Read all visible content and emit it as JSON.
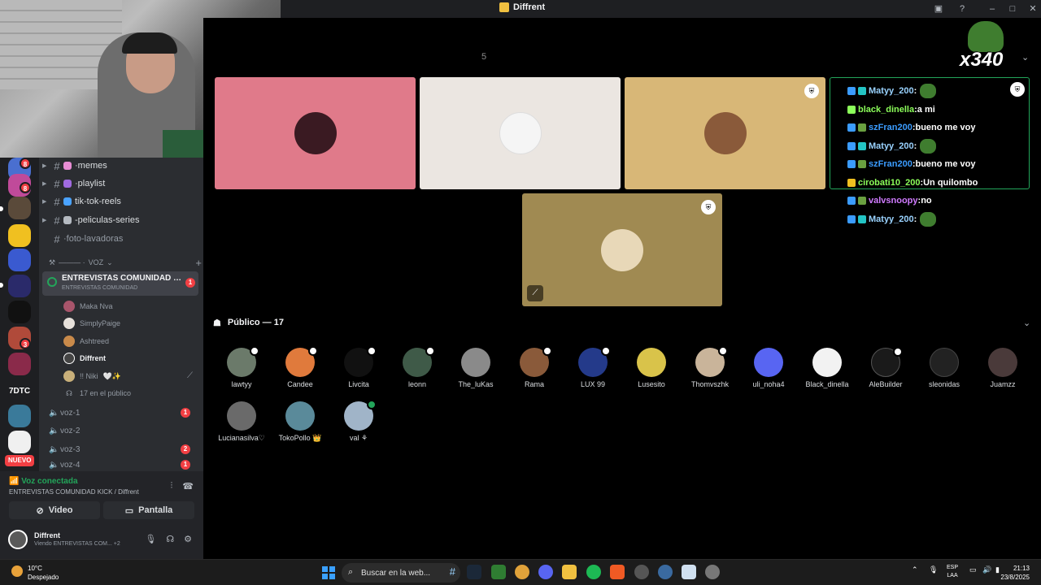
{
  "window": {
    "title": "Diffrent"
  },
  "stage_overlay": {
    "counter": "x340"
  },
  "chat": [
    {
      "user": "Matyy_200",
      "user_color": "#9ad3ff",
      "text": "",
      "emote": true
    },
    {
      "user": "black_dinella",
      "user_color": "#8cff5a",
      "text": "a mi",
      "emote": false
    },
    {
      "user": "szFran200",
      "user_color": "#3b9cff",
      "text": "bueno me voy",
      "emote": false
    },
    {
      "user": "Matyy_200",
      "user_color": "#9ad3ff",
      "text": "",
      "emote": true
    },
    {
      "user": "szFran200",
      "user_color": "#3b9cff",
      "text": "bueno me voy",
      "emote": false
    },
    {
      "user": "cirobati10_200",
      "user_color": "#8cff5a",
      "text": "Un quilombo",
      "emote": false
    },
    {
      "user": "valvsnoopy",
      "user_color": "#d07bff",
      "text": "no",
      "emote": false
    },
    {
      "user": "Matyy_200",
      "user_color": "#9ad3ff",
      "text": "",
      "emote": true
    }
  ],
  "chat_sep": " : ",
  "channels": {
    "text": [
      {
        "label": "memes",
        "prefix": "· ",
        "icon_color": "#e88dd4",
        "muted": false
      },
      {
        "label": "playlist",
        "prefix": "· ",
        "icon_color": "#a06be0",
        "muted": false
      },
      {
        "label": "tik-tok-reels",
        "prefix": "",
        "icon_color": "#4aa3ff",
        "muted": false
      },
      {
        "label": "-peliculas-series",
        "prefix": "",
        "icon_color": "#b5bac1",
        "muted": false
      },
      {
        "label": "foto-lavadoras",
        "prefix": "· ",
        "icon_color": "",
        "muted": true
      }
    ],
    "voice_category": "VOZ",
    "voice_category_prefix": "——— ·",
    "active_voice": {
      "name": "ENTREVISTAS COMUNIDAD K...",
      "sub": "ENTREVISTAS COMUNIDAD",
      "badge": "1"
    },
    "voice_users": [
      {
        "name": "Maka Nva",
        "bright": false,
        "color": "#a8556b"
      },
      {
        "name": "SimplyPaige",
        "bright": false,
        "color": "#e6e0da"
      },
      {
        "name": "Ashtreed",
        "bright": false,
        "color": "#c98a4a"
      },
      {
        "name": "Diffrent",
        "bright": true,
        "color": "#444"
      },
      {
        "name": "!! Niki",
        "bright": false,
        "color": "#c9b07a",
        "suffix": "🤍✨"
      }
    ],
    "audience_count": "17 en el público",
    "voice_channels": [
      {
        "label": "voz-1",
        "badge": "1"
      },
      {
        "label": "voz-2",
        "badge": ""
      },
      {
        "label": "voz-3",
        "badge": "2"
      },
      {
        "label": "voz-4",
        "badge": "1"
      }
    ]
  },
  "servers": {
    "badges": [
      "8",
      "8",
      "3"
    ],
    "nuevo": "NUEVO"
  },
  "voice_panel": {
    "status": "Voz conectada",
    "channel": "ENTREVISTAS COMUNIDAD KICK / Diffrent",
    "video_label": "Video",
    "screen_label": "Pantalla",
    "user_name": "Diffrent",
    "user_status": "Viendo ENTREVISTAS COM...",
    "user_extra": "+2"
  },
  "public": {
    "label": "Público — 17",
    "members": [
      {
        "name": "lawtyy",
        "color": "#6b7a6a",
        "hand": true
      },
      {
        "name": "Candee",
        "color": "#e07a3c",
        "hand": true
      },
      {
        "name": "Livcita",
        "color": "#111",
        "hand": true
      },
      {
        "name": "leonn",
        "color": "#3f5a48",
        "hand": true
      },
      {
        "name": "The_luKas",
        "color": "#8a8a8a",
        "hand": false
      },
      {
        "name": "Rama",
        "color": "#8a5a3a",
        "hand": true
      },
      {
        "name": "LUX 99",
        "color": "#243a8a",
        "hand": true
      },
      {
        "name": "Lusesito",
        "color": "#d9c34a",
        "hand": false
      },
      {
        "name": "Thomvszhk",
        "color": "#c9b49a",
        "hand": true
      },
      {
        "name": "uli_noha4",
        "color": "#5865f2",
        "hand": false
      },
      {
        "name": "Black_dinella",
        "color": "#f2f2f2",
        "hand": false
      },
      {
        "name": "AleBuilder",
        "color": "#1a1a1a",
        "hand": true
      },
      {
        "name": "sleonidas",
        "color": "#222",
        "hand": false
      },
      {
        "name": "Juamzz",
        "color": "#4a3a3a",
        "hand": false
      },
      {
        "name": "Lucianasilva♡",
        "color": "#6a6a6a",
        "hand": false
      },
      {
        "name": "TokoPollo 👑",
        "color": "#5a8a9a",
        "hand": false
      },
      {
        "name": "val ⚘",
        "color": "#a0b4c8",
        "hand": false
      }
    ]
  },
  "tiles": [
    {
      "bg": "#e07a8a",
      "avatar": "#3a1a22"
    },
    {
      "bg": "#ebe6e1",
      "avatar": "#f5f5f5"
    },
    {
      "bg": "#d8b777",
      "avatar": "#8a5a3a"
    },
    {
      "bg": "#a08a52",
      "avatar": "#e8d8b8"
    }
  ],
  "taskbar": {
    "temp": "10°C",
    "weather": "Despejado",
    "search_placeholder": "Buscar en la web...",
    "lang1": "ESP",
    "lang2": "LAA",
    "time": "21:13",
    "date": "23/8/2025"
  }
}
